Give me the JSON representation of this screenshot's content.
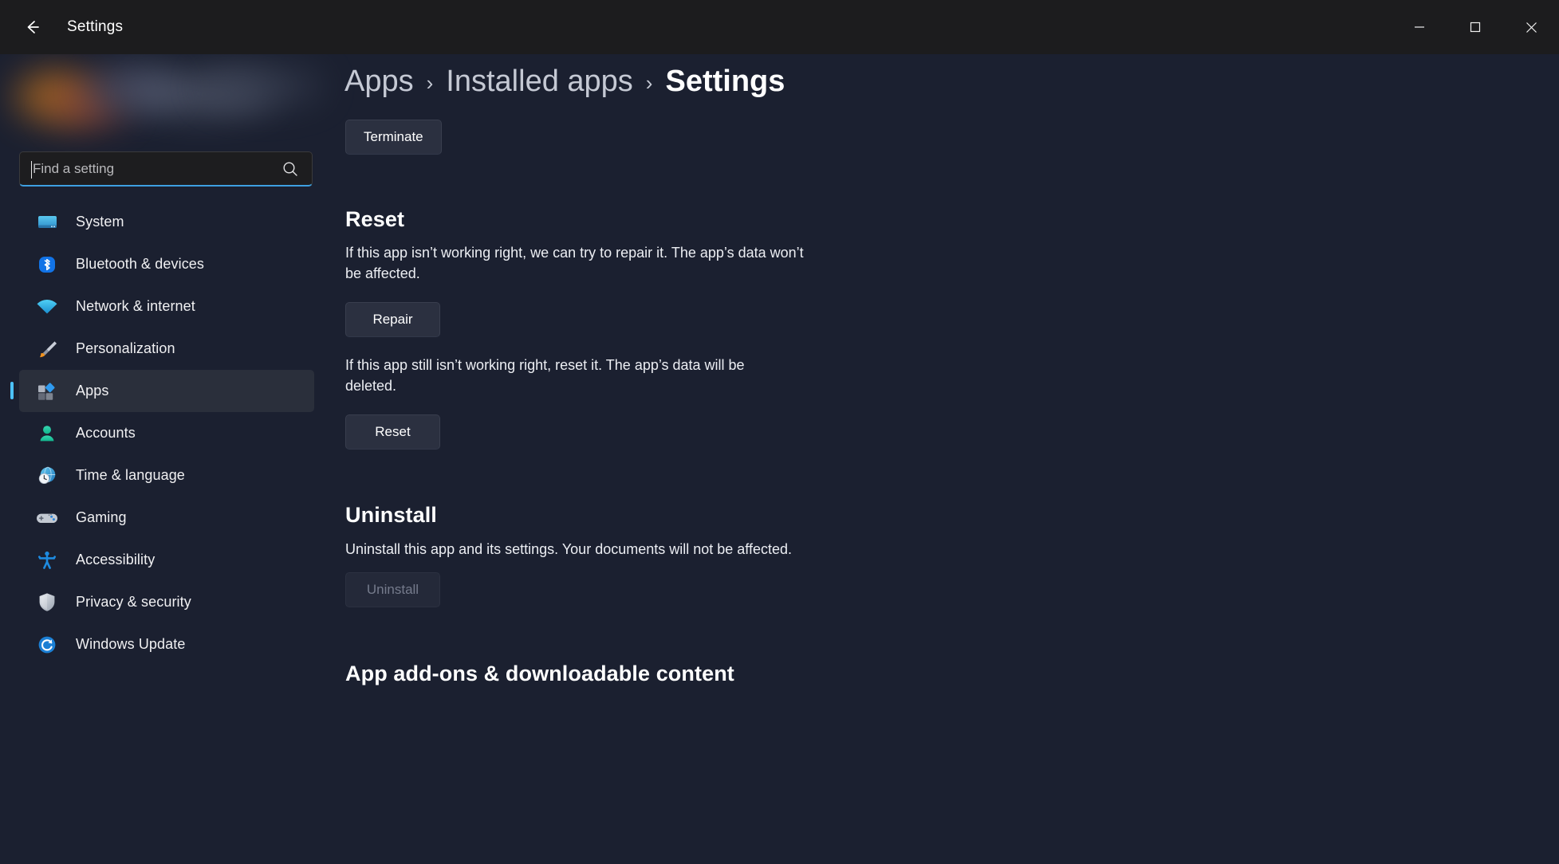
{
  "window": {
    "title": "Settings",
    "back_label": "Back",
    "controls": {
      "minimize": "Minimize",
      "maximize": "Maximize",
      "close": "Close"
    }
  },
  "sidebar": {
    "search": {
      "placeholder": "Find a setting",
      "value": ""
    },
    "items": [
      {
        "label": "System",
        "icon": "monitor-icon",
        "selected": false
      },
      {
        "label": "Bluetooth & devices",
        "icon": "bluetooth-icon",
        "selected": false
      },
      {
        "label": "Network & internet",
        "icon": "wifi-icon",
        "selected": false
      },
      {
        "label": "Personalization",
        "icon": "brush-icon",
        "selected": false
      },
      {
        "label": "Apps",
        "icon": "apps-icon",
        "selected": true
      },
      {
        "label": "Accounts",
        "icon": "person-icon",
        "selected": false
      },
      {
        "label": "Time & language",
        "icon": "clock-globe-icon",
        "selected": false
      },
      {
        "label": "Gaming",
        "icon": "gamepad-icon",
        "selected": false
      },
      {
        "label": "Accessibility",
        "icon": "accessibility-icon",
        "selected": false
      },
      {
        "label": "Privacy & security",
        "icon": "shield-icon",
        "selected": false
      },
      {
        "label": "Windows Update",
        "icon": "update-icon",
        "selected": false
      }
    ]
  },
  "breadcrumb": {
    "items": [
      {
        "label": "Apps",
        "current": false
      },
      {
        "label": "Installed apps",
        "current": false
      },
      {
        "label": "Settings",
        "current": true
      }
    ],
    "separator": "›"
  },
  "main": {
    "terminate_button": "Terminate",
    "reset": {
      "heading": "Reset",
      "repair_text": "If this app isn’t working right, we can try to repair it. The app’s data won’t be affected.",
      "repair_button": "Repair",
      "reset_text": "If this app still isn’t working right, reset it. The app’s data will be deleted.",
      "reset_button": "Reset"
    },
    "uninstall": {
      "heading": "Uninstall",
      "text": "Uninstall this app and its settings. Your documents will not be affected.",
      "button": "Uninstall",
      "button_disabled": true
    },
    "addons": {
      "heading": "App add-ons & downloadable content"
    }
  },
  "colors": {
    "accent": "#4cc2ff",
    "search_underline": "#3ea0e0",
    "background": "#1b2030",
    "titlebar": "#1c1c1e",
    "selected_nav": "#2a2f3b",
    "button": "#2b3040"
  }
}
